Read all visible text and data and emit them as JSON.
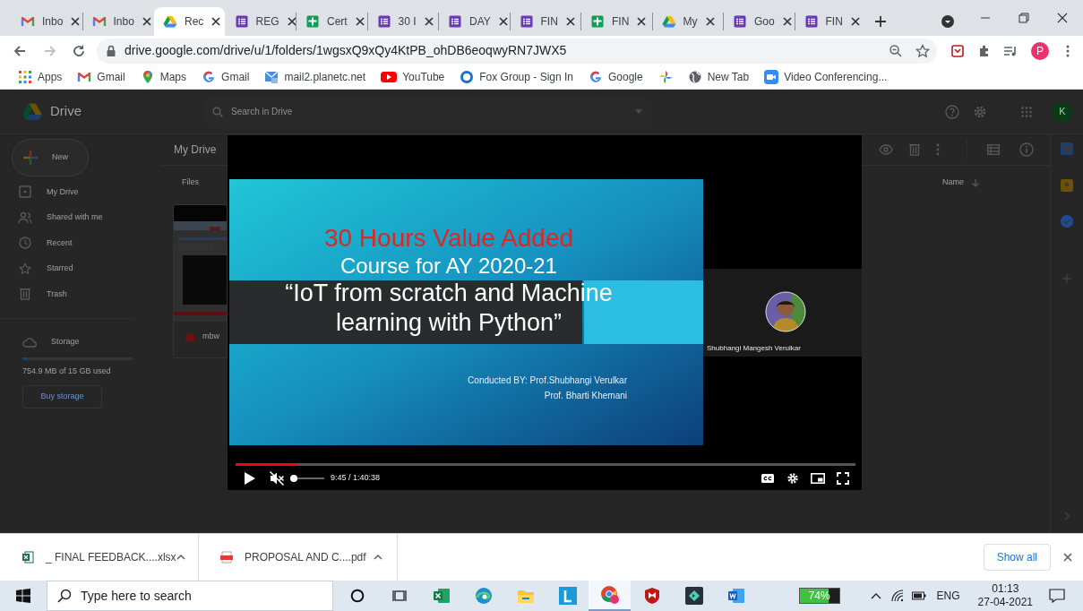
{
  "tabs": [
    {
      "kind": "gmail",
      "title": "Inbo",
      "selected": false
    },
    {
      "kind": "gmail",
      "title": "Inbo",
      "selected": false
    },
    {
      "kind": "drive",
      "title": "Rec",
      "selected": true
    },
    {
      "kind": "forms",
      "title": "REG",
      "selected": false
    },
    {
      "kind": "sheets",
      "title": "Cert",
      "selected": false
    },
    {
      "kind": "forms",
      "title": "30 I",
      "selected": false
    },
    {
      "kind": "forms",
      "title": "DAY",
      "selected": false
    },
    {
      "kind": "forms",
      "title": "FIN",
      "selected": false
    },
    {
      "kind": "sheets",
      "title": "FIN",
      "selected": false
    },
    {
      "kind": "drive",
      "title": "My",
      "selected": false
    },
    {
      "kind": "forms",
      "title": "Goo",
      "selected": false
    },
    {
      "kind": "forms",
      "title": "FIN",
      "selected": false
    }
  ],
  "address_bar": {
    "url": "drive.google.com/drive/u/1/folders/1wgsxQ9xQy4KtPB_ohDB6eoqwyRN7JWX5"
  },
  "profile_initial": "P",
  "bookmarks": [
    {
      "kind": "apps",
      "label": "Apps"
    },
    {
      "kind": "gmail",
      "label": "Gmail"
    },
    {
      "kind": "maps",
      "label": "Maps"
    },
    {
      "kind": "google",
      "label": "Gmail"
    },
    {
      "kind": "mail",
      "label": "mail2.planetc.net"
    },
    {
      "kind": "youtube",
      "label": "YouTube"
    },
    {
      "kind": "ring",
      "label": "Fox Group - Sign In"
    },
    {
      "kind": "google",
      "label": "Google"
    },
    {
      "kind": "photos"
    },
    {
      "kind": "globe",
      "label": "New Tab"
    },
    {
      "kind": "meet",
      "label": "Video Conferencing..."
    }
  ],
  "drive": {
    "logo": "Drive",
    "search_placeholder": "Search in Drive",
    "account_initial": "K",
    "new_button": "New",
    "nav": [
      {
        "kind": "drive",
        "label": "My Drive"
      },
      {
        "kind": "shared",
        "label": "Shared with me"
      },
      {
        "kind": "recent",
        "label": "Recent"
      },
      {
        "kind": "starred",
        "label": "Starred"
      },
      {
        "kind": "trash",
        "label": "Trash"
      }
    ],
    "storage": {
      "label": "Storage",
      "level": 0.05,
      "usage": "754.9 MB of 15 GB used",
      "buy_button": "Buy storage"
    },
    "breadcrumb": "My Drive",
    "section": "Files",
    "sort": "Name",
    "file": {
      "name": "mbw"
    }
  },
  "player": {
    "slide": {
      "title": "30 Hours Value Added",
      "subtitle": "Course for AY 2020-21",
      "quote_lines": [
        "“IoT from scratch and Machine",
        "learning with Python”"
      ],
      "credits": [
        "Conducted BY: Prof.Shubhangi Verulkar",
        "Prof. Bharti Khemani"
      ]
    },
    "participant": {
      "name": "Shubhangi Mangesh Verulkar"
    },
    "level": 0.1,
    "muted": true,
    "volume": {
      "level": 0
    },
    "time": "9:45 / 1:40:38"
  },
  "downloads": [
    {
      "kind": "xlsx",
      "name": "_ FINAL FEEDBACK....xlsx"
    },
    {
      "kind": "pdf",
      "name": "PROPOSAL AND C....pdf"
    }
  ],
  "show_all": "Show all",
  "taskbar": {
    "search_placeholder": "Type here to search",
    "apps": [
      {
        "kind": "cortana",
        "active": false
      },
      {
        "kind": "taskview",
        "active": false
      },
      {
        "kind": "excel",
        "active": false
      },
      {
        "kind": "edge",
        "active": false
      },
      {
        "kind": "explorer",
        "active": false
      },
      {
        "kind": "lapp",
        "active": false
      },
      {
        "kind": "chrome",
        "active": true
      },
      {
        "kind": "mcafee",
        "active": false
      },
      {
        "kind": "diamond",
        "active": false
      },
      {
        "kind": "word",
        "active": false
      }
    ],
    "battery": {
      "level": 0.74,
      "reading": "74%"
    },
    "language": "ENG",
    "time": "01:13",
    "date": "27-04-2021"
  }
}
